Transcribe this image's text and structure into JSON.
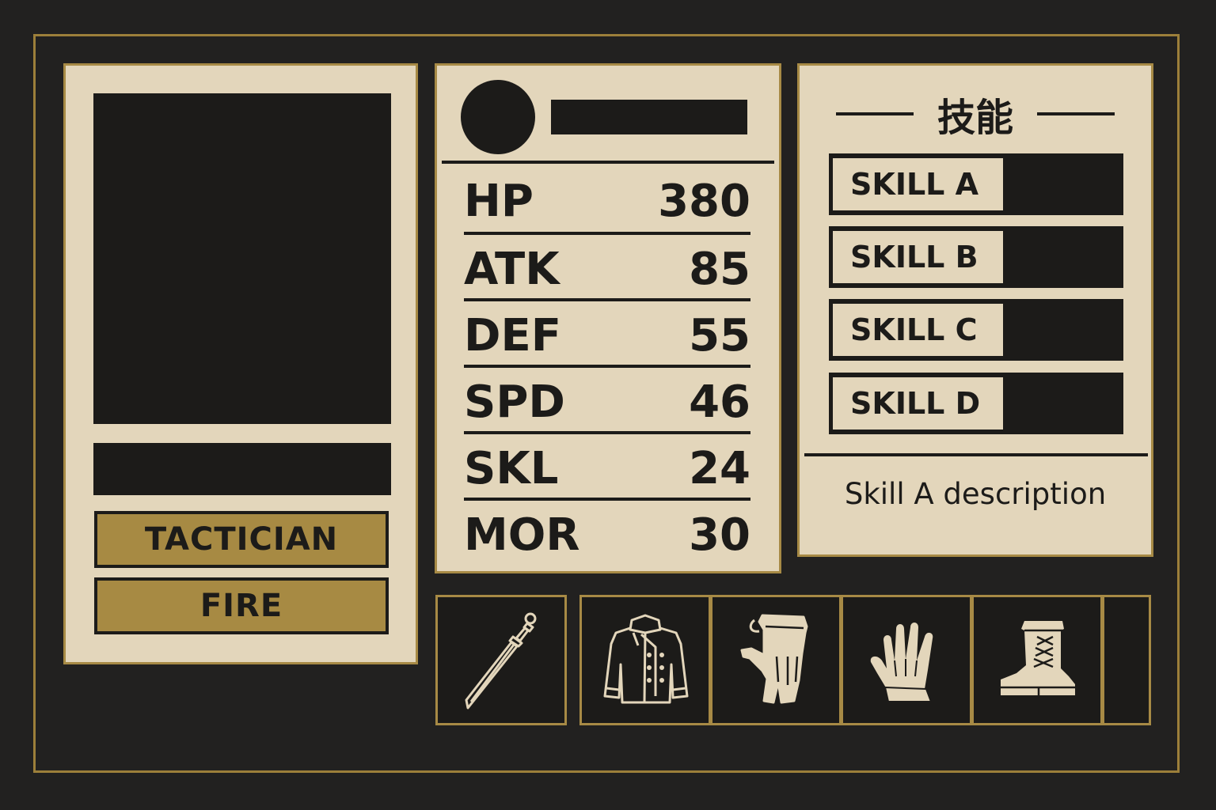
{
  "character": {
    "class_tag": "TACTICIAN",
    "element_tag": "FIRE"
  },
  "stats": [
    {
      "label": "HP",
      "value": "380"
    },
    {
      "label": "ATK",
      "value": "85"
    },
    {
      "label": "DEF",
      "value": "55"
    },
    {
      "label": "SPD",
      "value": "46"
    },
    {
      "label": "SKL",
      "value": "24"
    },
    {
      "label": "MOR",
      "value": "30"
    }
  ],
  "skills": {
    "title": "技能",
    "items": [
      {
        "label": "SKILL A"
      },
      {
        "label": "SKILL B"
      },
      {
        "label": "SKILL C"
      },
      {
        "label": "SKILL D"
      }
    ],
    "description": "Skill A description"
  },
  "equipment": [
    {
      "icon": "sword-icon"
    },
    {
      "icon": "jacket-icon"
    },
    {
      "icon": "gauntlet-icon"
    },
    {
      "icon": "glove-icon"
    },
    {
      "icon": "boot-icon"
    },
    {
      "icon": "empty-slot"
    }
  ],
  "colors": {
    "background": "#222120",
    "panel": "#e3d6bb",
    "accent_gold": "#a78a43",
    "ink": "#1c1b19"
  }
}
